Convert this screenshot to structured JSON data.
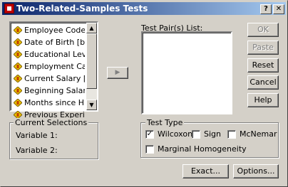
{
  "window": {
    "title": "Two-Related-Samples Tests",
    "help_glyph": "?",
    "close_glyph": "✕"
  },
  "variables": {
    "items": [
      {
        "label": "Employee Code [id]"
      },
      {
        "label": "Date of Birth [bdate]"
      },
      {
        "label": "Educational Level ("
      },
      {
        "label": "Employment Catego"
      },
      {
        "label": "Current Salary [sala"
      },
      {
        "label": "Beginning Salary [s"
      },
      {
        "label": "Months since Hire ["
      },
      {
        "label": "Previous Experienc"
      }
    ]
  },
  "move_button_glyph": "▶",
  "pairs": {
    "label": "Test Pair(s) List:"
  },
  "buttons": {
    "ok": "OK",
    "paste": "Paste",
    "reset": "Reset",
    "cancel": "Cancel",
    "help": "Help",
    "exact": "Exact...",
    "options": "Options..."
  },
  "current_selections": {
    "title": "Current Selections",
    "variable1": "Variable 1:",
    "variable2": "Variable 2:"
  },
  "test_type": {
    "title": "Test Type",
    "wilcoxon": {
      "label": "Wilcoxon",
      "checked": true
    },
    "sign": {
      "label": "Sign",
      "checked": false
    },
    "mcnemar": {
      "label": "McNemar",
      "checked": false
    },
    "marginal": {
      "label": "Marginal Homogeneity",
      "checked": false
    }
  },
  "check_glyph": "✓"
}
